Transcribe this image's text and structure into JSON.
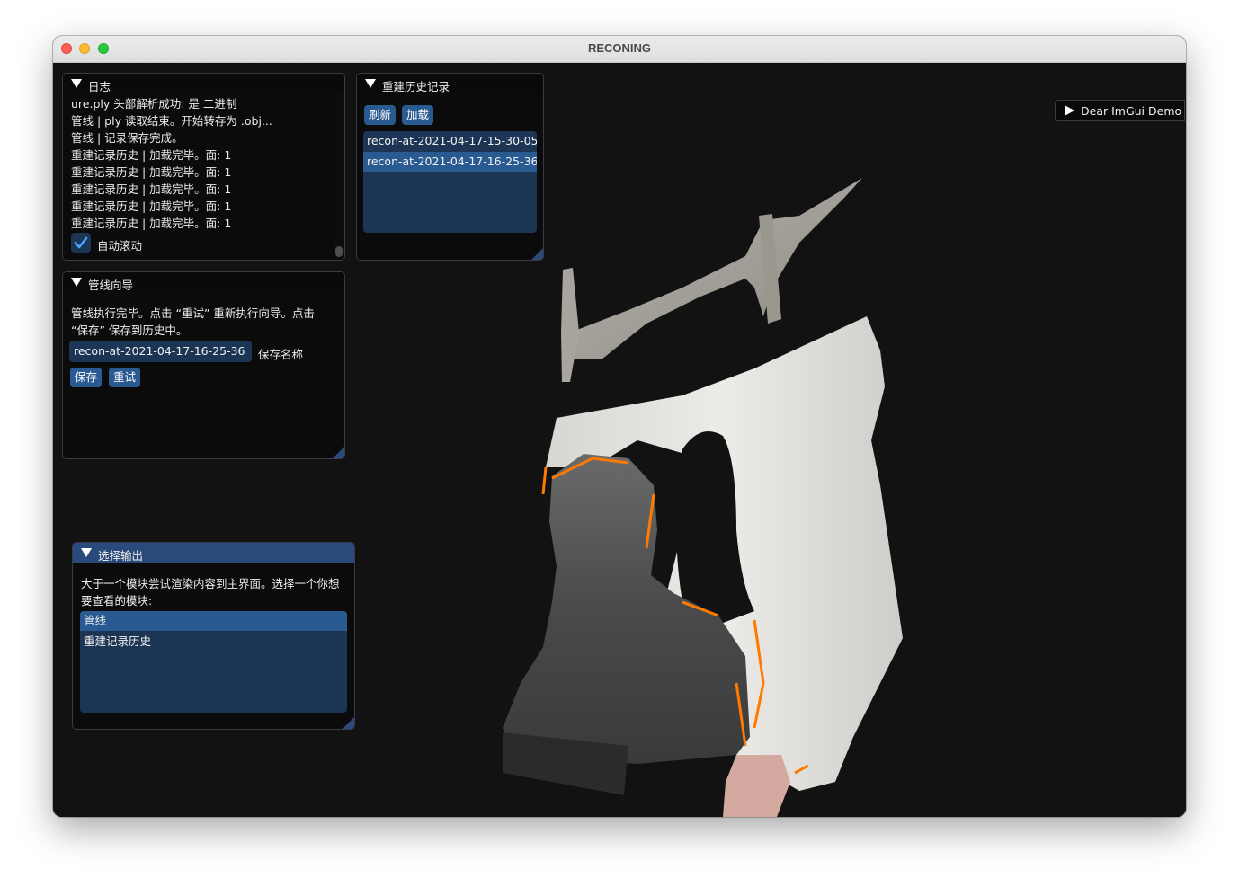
{
  "window": {
    "title": "RECONING"
  },
  "log_panel": {
    "title": "日志",
    "lines": [
      "ure.ply 头部解析成功: 是 二进制",
      "管线 | ply 读取结束。开始转存为 .obj...",
      "管线 | 记录保存完成。",
      "重建记录历史 | 加载完毕。面: 1",
      "重建记录历史 | 加载完毕。面: 1",
      "重建记录历史 | 加载完毕。面: 1",
      "重建记录历史 | 加载完毕。面: 1",
      "重建记录历史 | 加载完毕。面: 1"
    ],
    "auto_scroll_label": "自动滚动",
    "auto_scroll_checked": true
  },
  "history_panel": {
    "title": "重建历史记录",
    "refresh_label": "刷新",
    "load_label": "加载",
    "items": [
      "recon-at-2021-04-17-15-30-05",
      "recon-at-2021-04-17-16-25-36"
    ],
    "selected_index": 1
  },
  "wizard_panel": {
    "title": "管线向导",
    "message_lines": [
      "管线执行完毕。点击 “重试” 重新执行向导。点击",
      "“保存” 保存到历史中。"
    ],
    "save_name_value": "recon-at-2021-04-17-16-25-36",
    "save_name_label": "保存名称",
    "save_label": "保存",
    "retry_label": "重试"
  },
  "output_panel": {
    "title": "选择输出",
    "message_lines": [
      "大于一个模块尝试渲染内容到主界面。选择一个你想",
      "要查看的模块:"
    ],
    "items": [
      "管线",
      "重建记录历史"
    ],
    "selected_index": 0
  },
  "demo_window": {
    "label": "Dear ImGui Demo"
  },
  "colors": {
    "accent": "#2a5a92",
    "listbox_bg": "#1d3555",
    "active_header": "#294a7a",
    "viewport_bg": "#121212",
    "mesh_highlight": "#ff7a00"
  }
}
